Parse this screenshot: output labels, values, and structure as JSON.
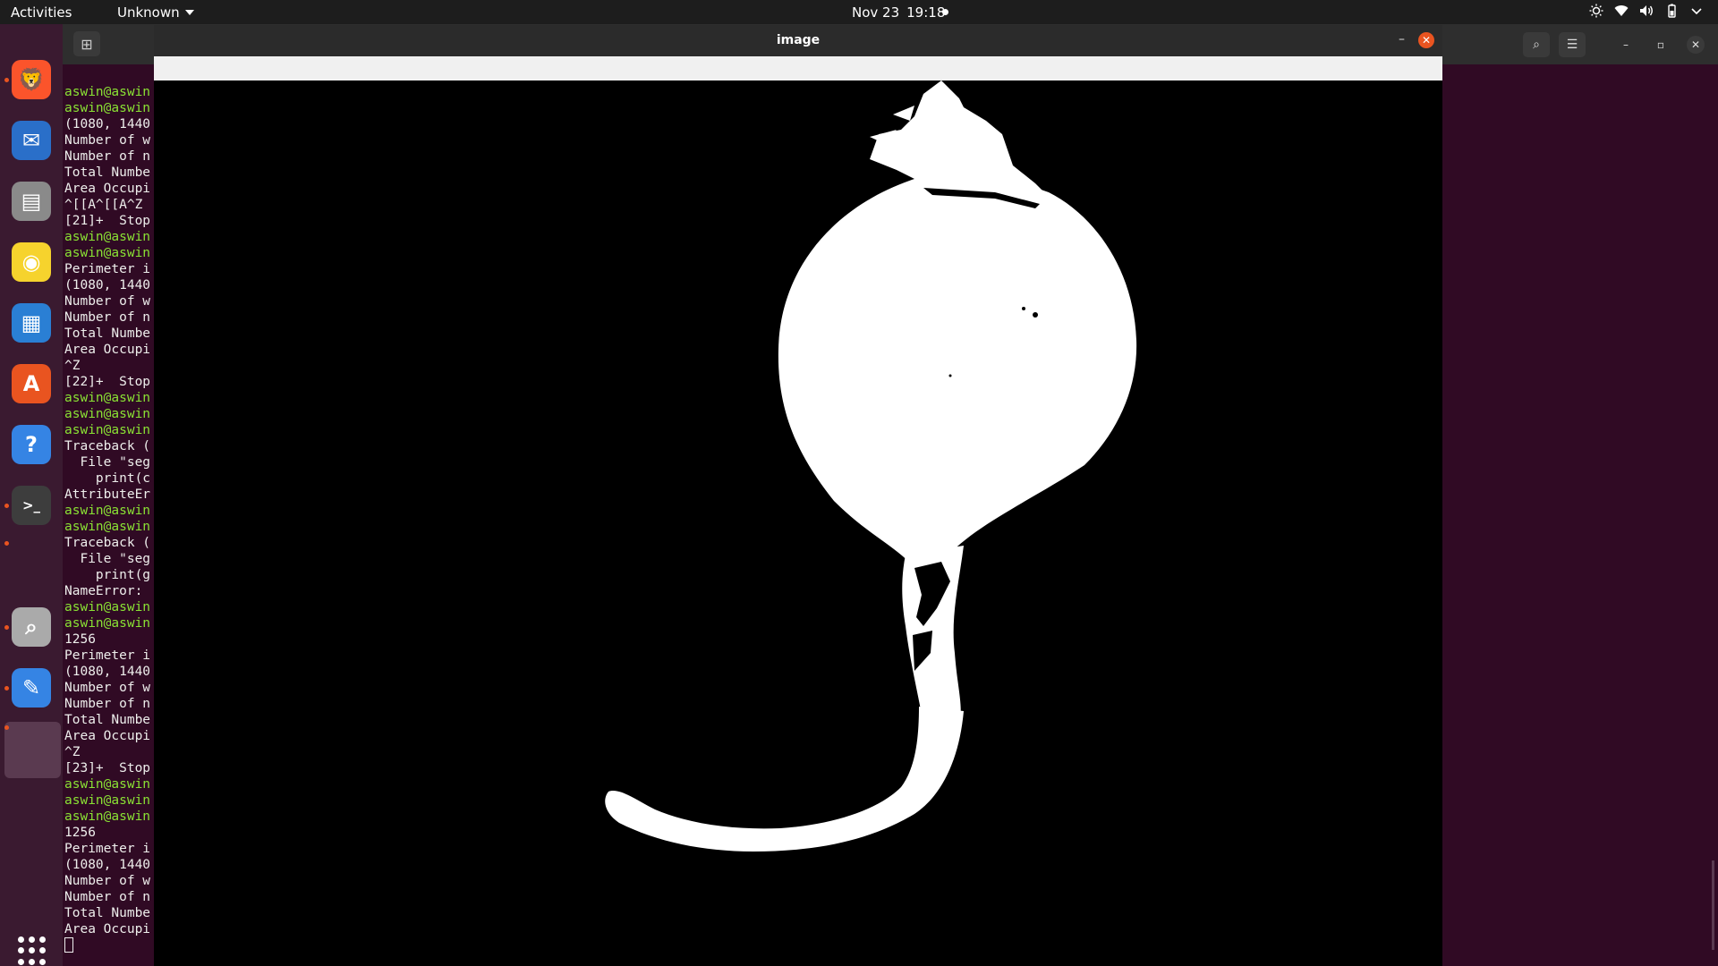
{
  "topbar": {
    "activities": "Activities",
    "app_menu": "Unknown",
    "date": "Nov 23",
    "time": "19:18",
    "tray_icons": [
      "brightness-icon",
      "wifi-icon",
      "volume-icon",
      "battery-icon",
      "chevron-down-icon"
    ]
  },
  "dock": {
    "items": [
      {
        "name": "brave-browser",
        "color": "#fb542b",
        "running": true
      },
      {
        "name": "thunderbird",
        "color": "#2a6fc9",
        "running": false
      },
      {
        "name": "files",
        "color": "#8a8a8a",
        "running": false
      },
      {
        "name": "rhythmbox",
        "color": "#f6d32d",
        "running": false
      },
      {
        "name": "libreoffice-writer",
        "color": "#2a7fd4",
        "running": false
      },
      {
        "name": "ubuntu-software",
        "color": "#e95420",
        "running": false
      },
      {
        "name": "help",
        "color": "#3584e4",
        "running": false
      },
      {
        "name": "terminal",
        "color": "#3d3d3d",
        "running": true
      },
      {
        "name": "image-viewer",
        "color": "#aaaaaa",
        "running": true
      },
      {
        "name": "text-editor",
        "color": "#3584e4",
        "running": true
      }
    ]
  },
  "terminal": {
    "lines": [
      {
        "t": "aswin@aswin",
        "g": true
      },
      {
        "t": "aswin@aswin",
        "g": true
      },
      {
        "t": "(1080, 1440",
        "g": false
      },
      {
        "t": "Number of w",
        "g": false
      },
      {
        "t": "Number of n",
        "g": false
      },
      {
        "t": "Total Numbe",
        "g": false
      },
      {
        "t": "Area Occupi",
        "g": false
      },
      {
        "t": "^[[A^[[A^Z",
        "g": false
      },
      {
        "t": "[21]+  Stop",
        "g": false
      },
      {
        "t": "aswin@aswin",
        "g": true
      },
      {
        "t": "aswin@aswin",
        "g": true
      },
      {
        "t": "Perimeter i",
        "g": false
      },
      {
        "t": "(1080, 1440",
        "g": false
      },
      {
        "t": "Number of w",
        "g": false
      },
      {
        "t": "Number of n",
        "g": false
      },
      {
        "t": "Total Numbe",
        "g": false
      },
      {
        "t": "Area Occupi",
        "g": false
      },
      {
        "t": "^Z",
        "g": false
      },
      {
        "t": "[22]+  Stop",
        "g": false
      },
      {
        "t": "aswin@aswin",
        "g": true
      },
      {
        "t": "aswin@aswin",
        "g": true
      },
      {
        "t": "aswin@aswin",
        "g": true
      },
      {
        "t": "Traceback (",
        "g": false
      },
      {
        "t": "  File \"seg",
        "g": false
      },
      {
        "t": "    print(c",
        "g": false
      },
      {
        "t": "AttributeEr",
        "g": false
      },
      {
        "t": "aswin@aswin",
        "g": true
      },
      {
        "t": "aswin@aswin",
        "g": true
      },
      {
        "t": "Traceback (",
        "g": false
      },
      {
        "t": "  File \"seg",
        "g": false
      },
      {
        "t": "    print(g",
        "g": false
      },
      {
        "t": "NameError: ",
        "g": false
      },
      {
        "t": "aswin@aswin",
        "g": true
      },
      {
        "t": "aswin@aswin",
        "g": true
      },
      {
        "t": "1256",
        "g": false
      },
      {
        "t": "Perimeter i",
        "g": false
      },
      {
        "t": "(1080, 1440",
        "g": false
      },
      {
        "t": "Number of w",
        "g": false
      },
      {
        "t": "Number of n",
        "g": false
      },
      {
        "t": "Total Numbe",
        "g": false
      },
      {
        "t": "Area Occupi",
        "g": false
      },
      {
        "t": "^Z",
        "g": false
      },
      {
        "t": "[23]+  Stop",
        "g": false
      },
      {
        "t": "aswin@aswin",
        "g": true
      },
      {
        "t": "aswin@aswin",
        "g": true
      },
      {
        "t": "aswin@aswin",
        "g": true
      },
      {
        "t": "1256",
        "g": false
      },
      {
        "t": "Perimeter i",
        "g": false
      },
      {
        "t": "(1080, 1440",
        "g": false
      },
      {
        "t": "Number of w",
        "g": false
      },
      {
        "t": "Number of n",
        "g": false
      },
      {
        "t": "Total Numbe",
        "g": false
      },
      {
        "t": "Area Occupi",
        "g": false
      }
    ]
  },
  "image_window": {
    "title": "image",
    "image_description_icon": "binary-mask-onion"
  },
  "colors": {
    "accent": "#e95420",
    "prompt_green": "#8ae234",
    "terminal_bg": "#300a24"
  }
}
